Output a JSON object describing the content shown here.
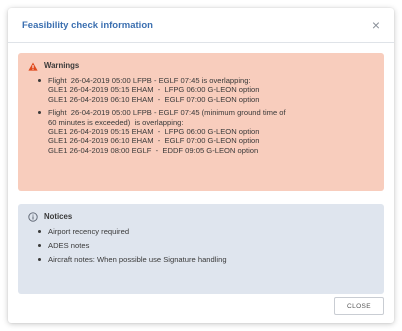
{
  "dialog": {
    "title": "Feasibility check information",
    "close_icon_glyph": "×",
    "close_button_label": "CLOSE"
  },
  "warnings": {
    "heading": "Warnings",
    "icon": "warning-triangle-icon",
    "color": "#e0491c",
    "items": [
      {
        "lines": [
          "Flight  26-04-2019 05:00 LFPB - EGLF 07:45 is overlapping:",
          "GLE1 26-04-2019 05:15 EHAM  -  LFPG 06:00 G-LEON option",
          "GLE1 26-04-2019 06:10 EHAM  -  EGLF 07:00 G-LEON option"
        ]
      },
      {
        "lines": [
          "Flight  26-04-2019 05:00 LFPB - EGLF 07:45 (minimum ground time of",
          "60 minutes is exceeded)  is overlapping:",
          "GLE1 26-04-2019 05:15 EHAM  -  LFPG 06:00 G-LEON option",
          "GLE1 26-04-2019 06:10 EHAM  -  EGLF 07:00 G-LEON option",
          "GLE1 26-04-2019 08:00 EGLF  -  EDDF 09:05 G-LEON option"
        ]
      }
    ]
  },
  "notices": {
    "heading": "Notices",
    "icon": "info-circle-icon",
    "items": [
      "Airport recency required",
      "ADES notes",
      "Aircraft notes: When possible use Signature handling"
    ]
  }
}
